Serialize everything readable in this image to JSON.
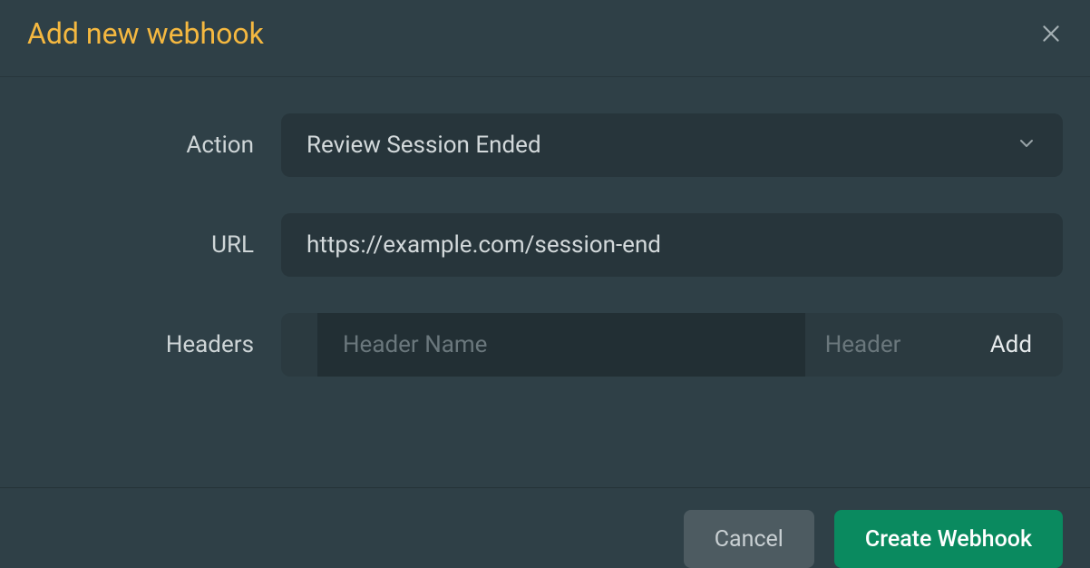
{
  "modal": {
    "title": "Add new webhook"
  },
  "form": {
    "action": {
      "label": "Action",
      "selected": "Review Session Ended"
    },
    "url": {
      "label": "URL",
      "value": "https://example.com/session-end"
    },
    "headers": {
      "label": "Headers",
      "name_placeholder": "Header Name",
      "value_placeholder": "Header",
      "add_label": "Add"
    }
  },
  "footer": {
    "cancel": "Cancel",
    "submit": "Create Webhook"
  }
}
